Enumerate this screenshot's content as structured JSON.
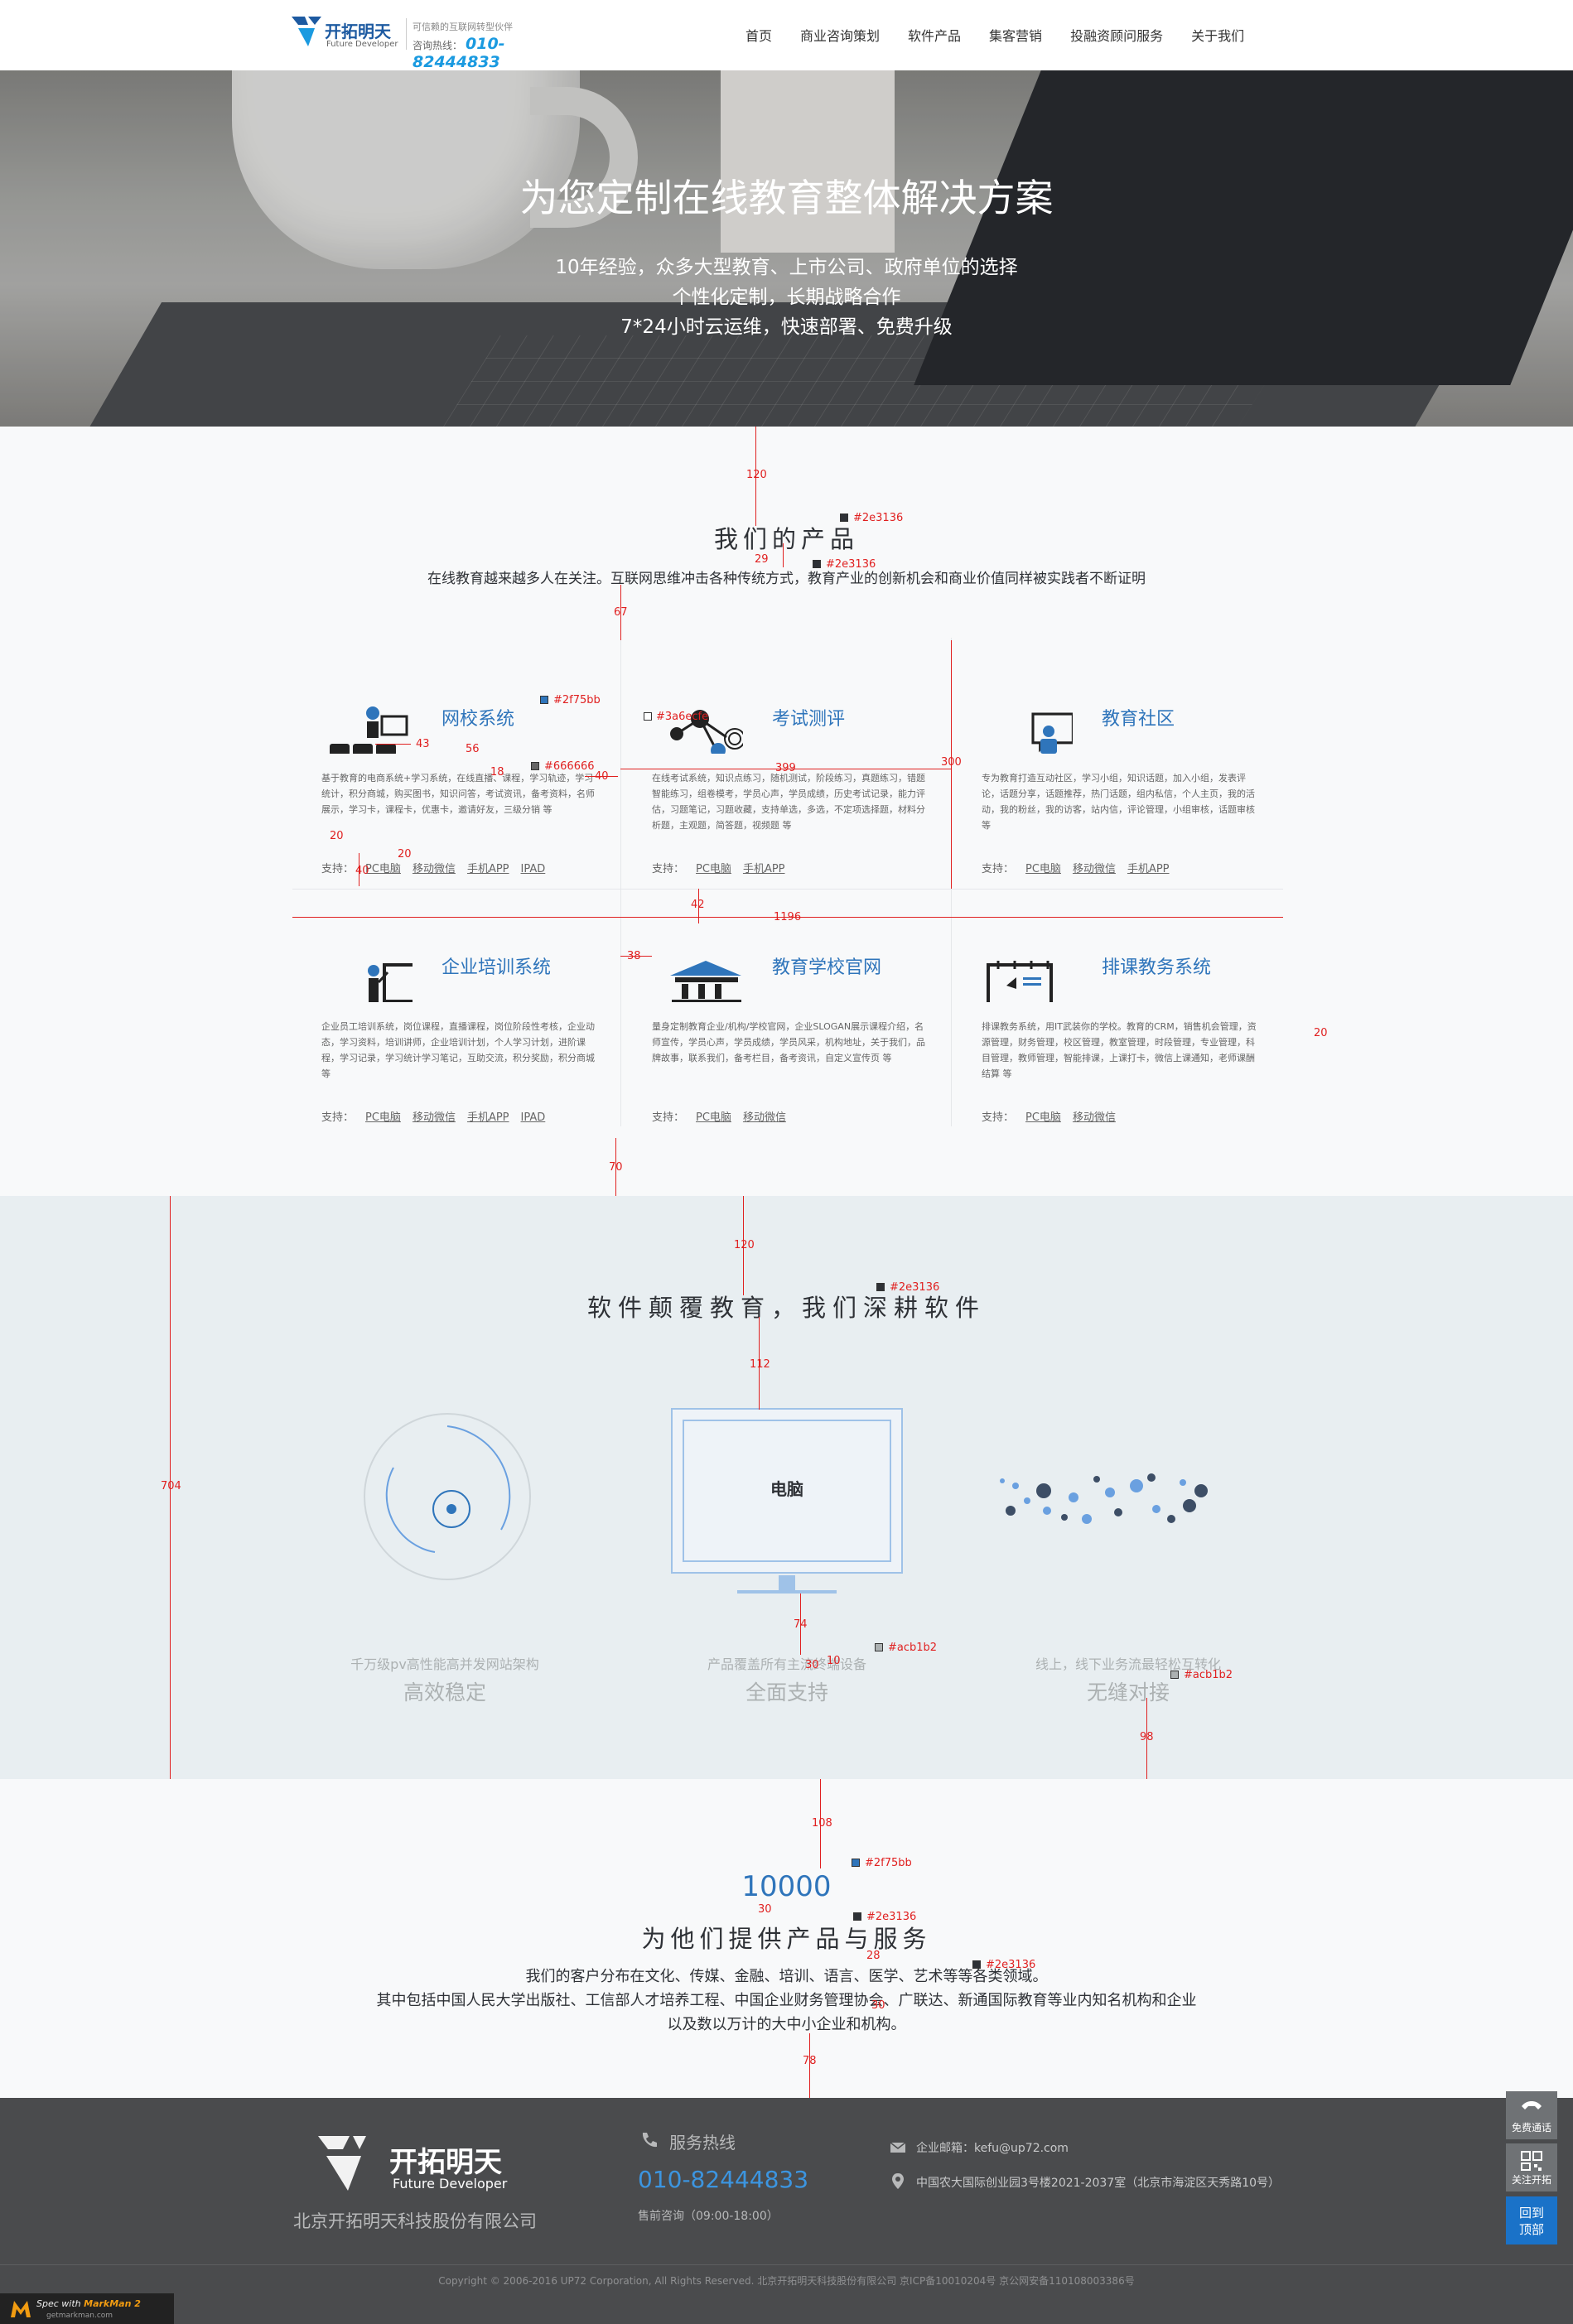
{
  "header": {
    "brand": "开拓明天",
    "brand_en": "Future Developer",
    "tagline": "可信赖的互联网转型伙伴",
    "hotline_label": "咨询热线：",
    "hotline": "010-82444833",
    "nav": [
      "首页",
      "商业咨询策划",
      "软件产品",
      "集客营销",
      "投融资顾问服务",
      "关于我们"
    ]
  },
  "banner": {
    "title": "为您定制在线教育整体解决方案",
    "lines": [
      "10年经验，众多大型教育、上市公司、政府单位的选择",
      "个性化定制，长期战略合作",
      "7*24小时云运维，快速部署、免费升级"
    ]
  },
  "products": {
    "title": "我们的产品",
    "desc": "在线教育越来越多人在关注。互联网思维冲击各种传统方式，教育产业的创新机会和商业价值同样被实践者不断证明",
    "support_label": "支持：",
    "items": [
      {
        "name": "网校系统",
        "icon": "classroom-icon",
        "desc": "基于教育的电商系统+学习系统，在线直播、课程，学习轨迹，学习统计，积分商城，购买图书，知识问答，考试资讯，备考资料，名师展示，学习卡，课程卡，优惠卡，邀请好友，三级分销 等",
        "support": [
          "PC电脑",
          "移动微信",
          "手机APP",
          "IPAD"
        ]
      },
      {
        "name": "考试测评",
        "icon": "network-icon",
        "desc": "在线考试系统，知识点练习，随机测试，阶段练习，真题练习，错题智能练习，组卷模考，学员心声，学员成绩，历史考试记录，能力评估，习题笔记，习题收藏，支持单选，多选，不定项选择题，材料分析题，主观题，简答题，视频题 等",
        "support": [
          "PC电脑",
          "手机APP"
        ]
      },
      {
        "name": "教育社区",
        "icon": "community-icon",
        "desc": "专为教育打造互动社区，学习小组，知识话题，加入小组，发表评论，话题分享，话题推荐，热门话题，组内私信，个人主页，我的活动，我的粉丝，我的访客，站内信，评论管理，小组审核，话题审核 等",
        "support": [
          "PC电脑",
          "移动微信",
          "手机APP"
        ]
      },
      {
        "name": "企业培训系统",
        "icon": "training-icon",
        "desc": "企业员工培训系统，岗位课程，直播课程，岗位阶段性考核，企业动态，学习资料，培训讲师，企业培训计划，个人学习计划，进阶课程，学习记录，学习统计学习笔记，互助交流，积分奖励，积分商城 等",
        "support": [
          "PC电脑",
          "移动微信",
          "手机APP",
          "IPAD"
        ]
      },
      {
        "name": "教育学校官网",
        "icon": "school-icon",
        "desc": "量身定制教育企业/机构/学校官网，企业SLOGAN展示课程介绍，名师宣传，学员心声，学员成绩，学员风采，机构地址，关于我们，品牌故事，联系我们，备考栏目，备考资讯，自定义宣传页 等",
        "support": [
          "PC电脑",
          "移动微信"
        ]
      },
      {
        "name": "排课教务系统",
        "icon": "schedule-icon",
        "desc": "排课教务系统，用IT武装你的学校。教育的CRM，销售机会管理，资源管理，财务管理，校区管理，教室管理，时段管理，专业管理，科目管理，教师管理，智能排课，上课打卡，微信上课通知，老师课酬结算 等",
        "support": [
          "PC电脑",
          "移动微信"
        ]
      }
    ]
  },
  "software": {
    "title": "软件颠覆教育，我们深耕软件",
    "screen_label": "电脑",
    "features": [
      {
        "sub": "千万级pv高性能高并发网站架构",
        "main": "高效稳定"
      },
      {
        "sub": "产品覆盖所有主流终端设备",
        "main": "全面支持"
      },
      {
        "sub": "线上，线下业务流最轻松互转化",
        "main": "无缝对接"
      }
    ]
  },
  "clients": {
    "number": "10000",
    "title": "为他们提供产品与服务",
    "lines": [
      "我们的客户分布在文化、传媒、金融、培训、语言、医学、艺术等等各类领域。",
      "其中包括中国人民大学出版社、工信部人才培养工程、中国企业财务管理协会、广联达、新通国际教育等业内知名机构和企业",
      "以及数以万计的大中小企业和机构。"
    ]
  },
  "footer": {
    "brand": "开拓明天",
    "brand_en": "Future Developer",
    "company": "北京开拓明天科技股份有限公司",
    "hotline_label": "服务热线",
    "hotline": "010-82444833",
    "hotline_time": "售前咨询（09:00-18:00）",
    "email": "企业邮箱：kefu@up72.com",
    "address": "中国农大国际创业园3号楼2021-2037室（北京市海淀区天秀路10号）",
    "copyright": "Copyright © 2006-2016 UP72 Corporation, All Rights Reserved. 北京开拓明天科技股份有限公司 京ICP备10010204号 京公网安备110108003386号",
    "spec_text": "Spec with",
    "spec_brand": "MarkMan 2",
    "spec_url": "getmarkman.com"
  },
  "floating": {
    "call": "免费通话",
    "follow": "关注开拓",
    "top": [
      "回到",
      "顶部"
    ]
  },
  "annotations": {
    "colors": {
      "title": "#2e3136",
      "desc": "#2e3136",
      "name": "#2f75bb",
      "text": "#666666",
      "icon": "#3a6ecfe",
      "feature": "#acb1b2",
      "number": "#2f75bb"
    },
    "labels": {
      "c1": "#2e3136",
      "c2": "#2e3136",
      "c3": "#2f75bb",
      "c4": "#666666",
      "c5": "#3a6ecfe",
      "c6": "#2e3136",
      "c7": "#acb1b2",
      "c8": "#acb1b2",
      "c9": "#2f75bb",
      "c10": "#2e3136",
      "c11": "#2e3136",
      "m120a": "120",
      "m29": "29",
      "m67": "67",
      "m43": "43",
      "m56": "56",
      "m18": "18",
      "m40": "40",
      "m20a": "20",
      "m40b": "40",
      "m20b": "20",
      "m399": "399",
      "m300": "300",
      "m42": "42",
      "m1196": "1196",
      "m38": "38",
      "m20c": "20",
      "m70": "70",
      "m120b": "120",
      "m112": "112",
      "m704": "704",
      "m74": "74",
      "m30a": "30",
      "m10": "10",
      "m98": "98",
      "m108": "108",
      "m30b": "30",
      "m28": "28",
      "m30c": "30",
      "m78": "78"
    }
  }
}
